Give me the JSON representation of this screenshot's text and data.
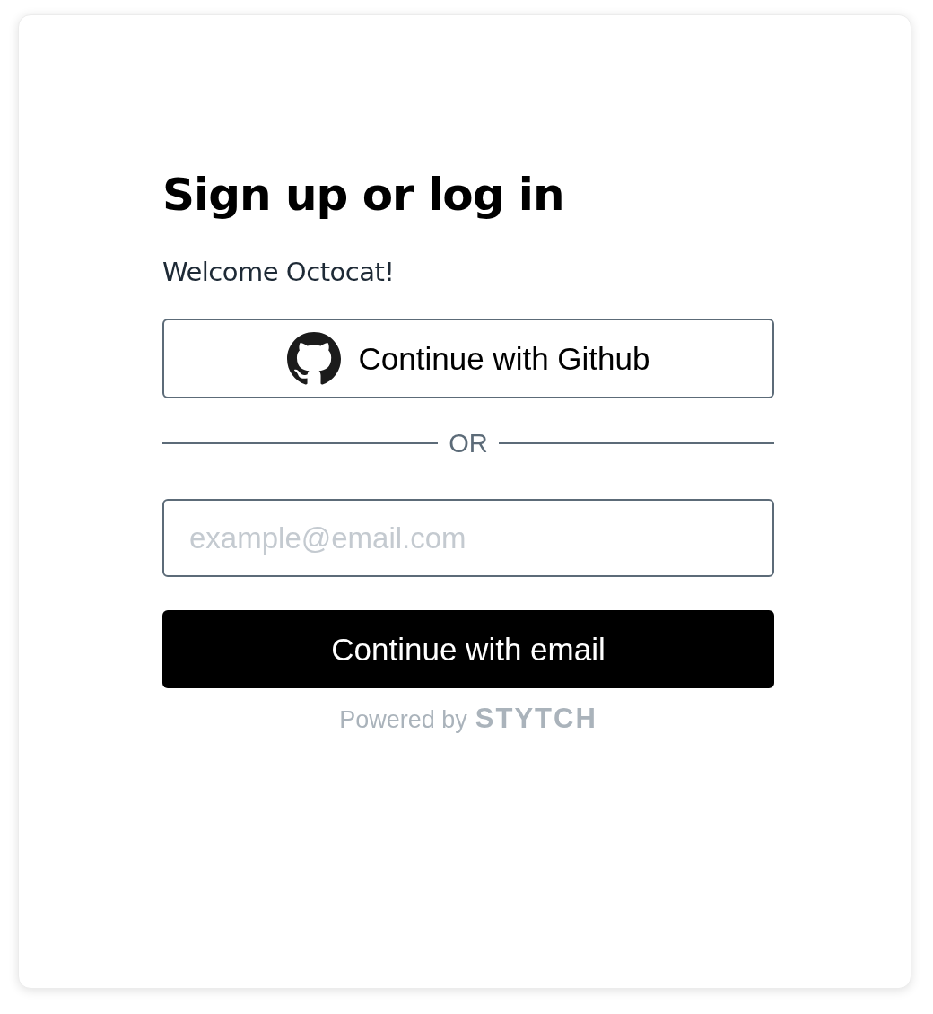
{
  "title": "Sign up or log in",
  "subtitle": "Welcome Octocat!",
  "oauth_button": {
    "label": "Continue with Github"
  },
  "divider": "OR",
  "email_field": {
    "placeholder": "example@email.com"
  },
  "submit_button": {
    "label": "Continue with email"
  },
  "footer": {
    "prefix": "Powered by",
    "brand": "STYTCH"
  }
}
